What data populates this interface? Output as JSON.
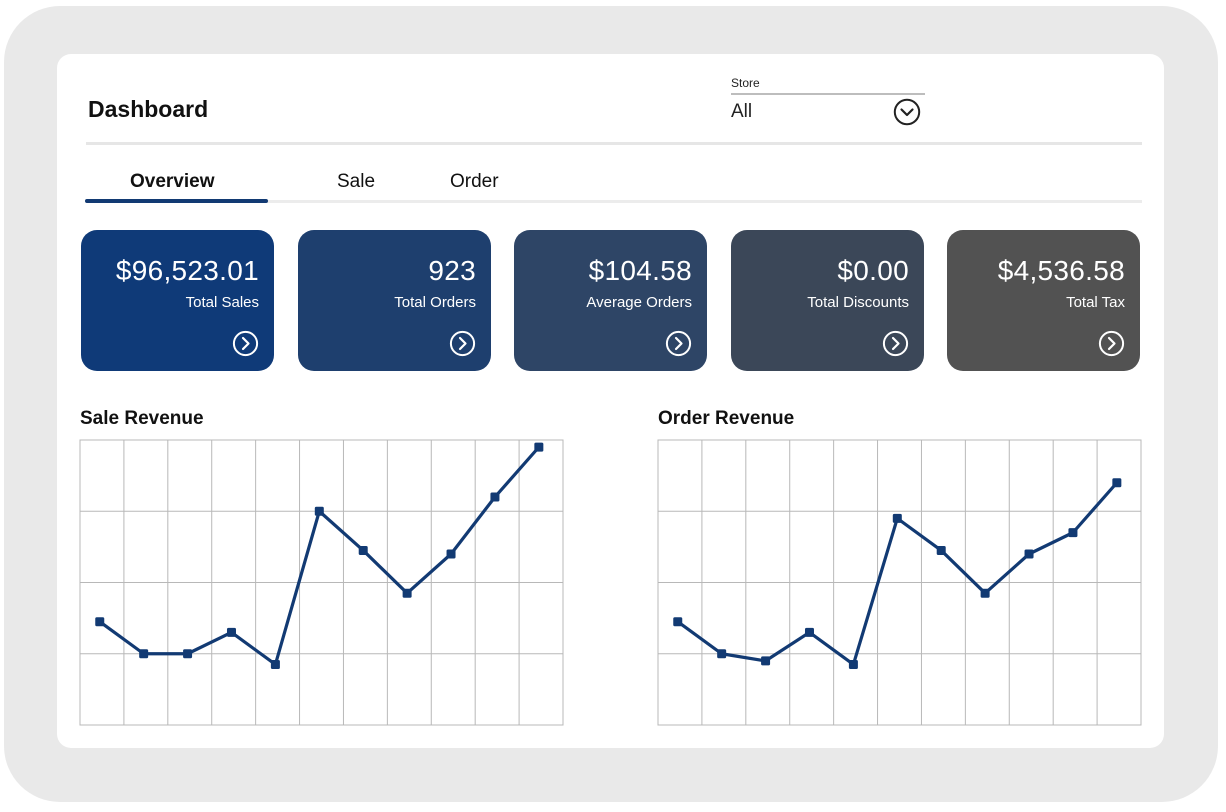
{
  "header": {
    "title": "Dashboard",
    "store": {
      "label": "Store",
      "value": "All"
    }
  },
  "tabs": [
    {
      "label": "Overview",
      "active": true
    },
    {
      "label": "Sale",
      "active": false
    },
    {
      "label": "Order",
      "active": false
    }
  ],
  "cards": [
    {
      "value": "$96,523.01",
      "label": "Total Sales",
      "color": "#0f3a78"
    },
    {
      "value": "923",
      "label": "Total Orders",
      "color": "#1e3f6e"
    },
    {
      "value": "$104.58",
      "label": "Average Orders",
      "color": "#2e4566"
    },
    {
      "value": "$0.00",
      "label": "Total Discounts",
      "color": "#3b4758"
    },
    {
      "value": "$4,536.58",
      "label": "Total Tax",
      "color": "#525252"
    }
  ],
  "colors": {
    "line": "#123a73",
    "grid": "#b8b8b8"
  },
  "chart_data": [
    {
      "type": "line",
      "title": "Sale Revenue",
      "x": [
        1,
        2,
        3,
        4,
        5,
        6,
        7,
        8,
        9,
        10,
        11
      ],
      "values": [
        1.45,
        1.0,
        1.0,
        1.3,
        0.85,
        3.0,
        2.45,
        1.85,
        2.4,
        3.2,
        3.9
      ],
      "xlim": [
        0.55,
        11.55
      ],
      "ylim": [
        0,
        4
      ],
      "grid": true
    },
    {
      "type": "line",
      "title": "Order Revenue",
      "x": [
        1,
        2,
        3,
        4,
        5,
        6,
        7,
        8,
        9,
        10,
        11
      ],
      "values": [
        1.45,
        1.0,
        0.9,
        1.3,
        0.85,
        2.9,
        2.45,
        1.85,
        2.4,
        2.7,
        3.4
      ],
      "xlim": [
        0.55,
        11.55
      ],
      "ylim": [
        0,
        4
      ],
      "grid": true
    }
  ]
}
